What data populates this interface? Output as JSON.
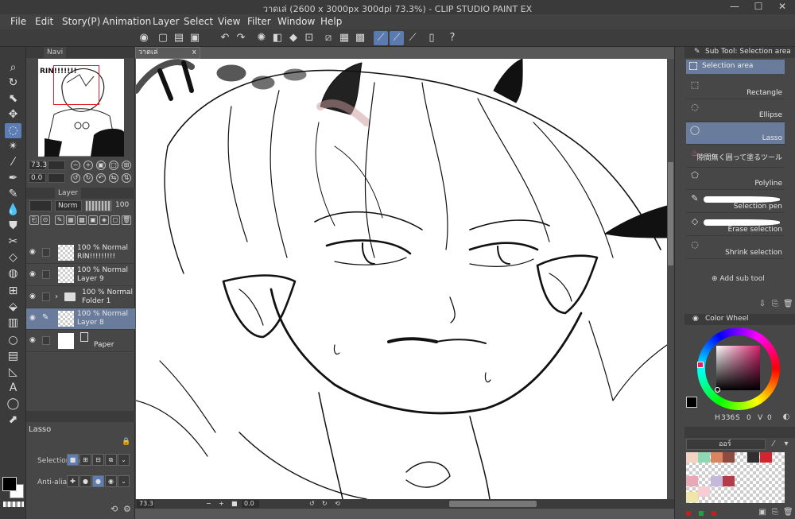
{
  "window": {
    "title": "วาดเล่ (2600 x 3000px 300dpi 73.3%)  - CLIP STUDIO PAINT EX",
    "min": "—",
    "max": "☐",
    "close": "✕"
  },
  "menu": [
    "File",
    "Edit",
    "Story(P)",
    "Animation",
    "Layer",
    "Select",
    "View",
    "Filter",
    "Window",
    "Help"
  ],
  "navigator": {
    "tab": "Navi",
    "zoom": "73.3",
    "angle": "0.0"
  },
  "layer_panel": {
    "tab": "Layer",
    "blend_mode": "Norm",
    "opacity": "100",
    "layers": [
      {
        "opacity_mode": "100 % Normal",
        "name": "RIN!!!!!!!!!"
      },
      {
        "opacity_mode": "100 % Normal",
        "name": "Layer 9"
      },
      {
        "opacity_mode": "100 % Normal",
        "name": "Folder 1"
      },
      {
        "opacity_mode": "100 % Normal",
        "name": "Layer 8"
      },
      {
        "opacity_mode": "",
        "name": "Paper"
      }
    ]
  },
  "tool_property": {
    "title": "Lasso",
    "selection_mode_label": "Selection m",
    "antialias_label": "Anti-aliasin"
  },
  "canvas": {
    "tab_title": "วาดเล่",
    "tab_close": "x",
    "zoom": "73.3",
    "angle": "0.0"
  },
  "sub_tool": {
    "header": "Sub Tool: Selection area",
    "group": "Selection area",
    "items": [
      {
        "label": "Rectangle"
      },
      {
        "label": "Ellipse"
      },
      {
        "label": "Lasso"
      },
      {
        "label": "隙間無く囲って塗るツール"
      },
      {
        "label": "Polyline"
      },
      {
        "label": "Selection pen"
      },
      {
        "label": "Erase selection"
      },
      {
        "label": "Shrink selection"
      }
    ],
    "add_label": "Add sub tool"
  },
  "color_wheel": {
    "header": "Color Wheel",
    "h_label": "H",
    "h_value": "336",
    "s_label": "S",
    "s_value": "0",
    "v_label": "V",
    "v_value": "0"
  },
  "color_set": {
    "name": "ออร์"
  },
  "colors": {
    "accent": "#5d7db5",
    "palette": [
      "#f3d3c2",
      "#8ed8b4",
      "#d9865e",
      "#8f4b3f",
      "#303030",
      "#d2262e",
      "#e8a8b8",
      "#c4b8dd",
      "#b33b4a",
      "#f7cdd4",
      "#f0e6a8"
    ]
  }
}
